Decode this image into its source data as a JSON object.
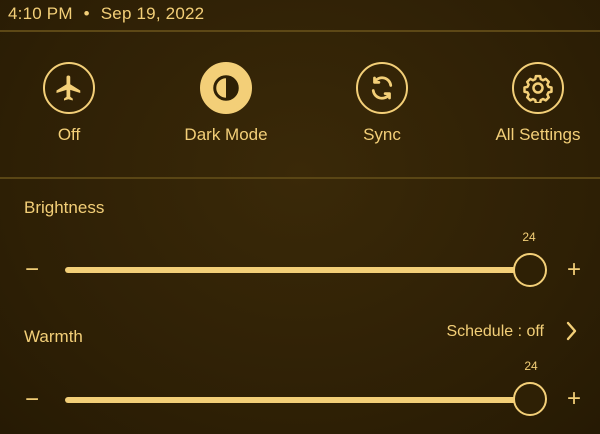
{
  "status": {
    "time": "4:10 PM",
    "separator": "•",
    "date": "Sep 19, 2022"
  },
  "quick_actions": [
    {
      "label": "Off",
      "icon": "airplane-icon",
      "active": false
    },
    {
      "label": "Dark Mode",
      "icon": "dark-mode-icon",
      "active": true
    },
    {
      "label": "Sync",
      "icon": "sync-icon",
      "active": false
    },
    {
      "label": "All Settings",
      "icon": "gear-icon",
      "active": false
    }
  ],
  "brightness": {
    "label": "Brightness",
    "value": "24",
    "minus": "−",
    "plus": "+"
  },
  "warmth": {
    "label": "Warmth",
    "value": "24",
    "minus": "−",
    "plus": "+",
    "schedule": "Schedule : off"
  },
  "colors": {
    "accent": "#f3cf78",
    "background": "#2d1f05"
  }
}
